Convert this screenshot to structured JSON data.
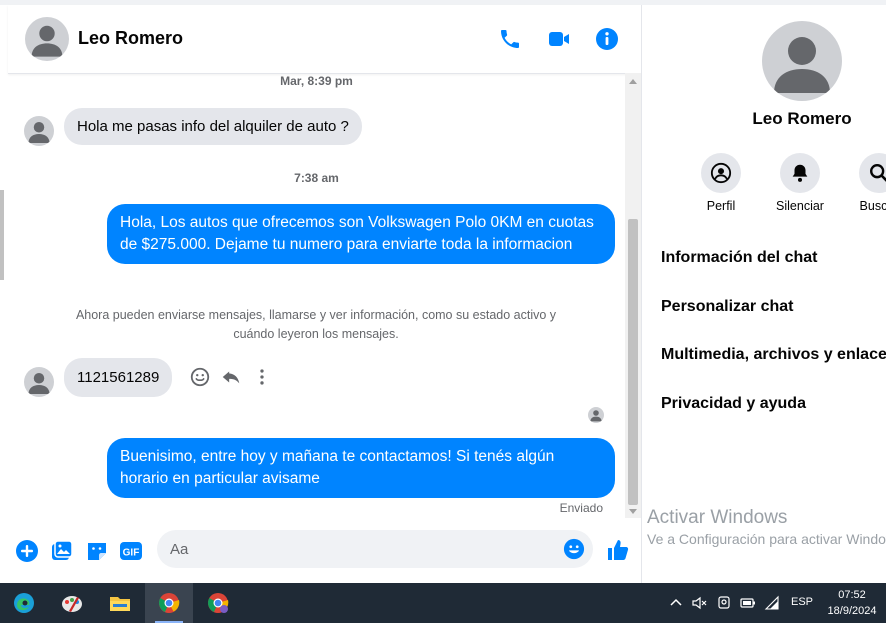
{
  "contact": {
    "name": "Leo Romero"
  },
  "messages": {
    "ts1": "Mar, 8:39 pm",
    "m1": "Hola me pasas info del alquiler de auto ?",
    "ts2": "7:38 am",
    "m2": "Hola, Los autos que ofrecemos son Volkswagen Polo 0KM en cuotas de $275.000. Dejame tu numero para enviarte toda la informacion",
    "system": "Ahora pueden enviarse mensajes, llamarse y ver información, como su estado activo y cuándo leyeron los mensajes.",
    "m3": "1121561289",
    "m4": "Buenisimo, entre hoy y mañana te contactamos! Si tenés algún horario en particular avisame",
    "status": "Enviado"
  },
  "composer": {
    "placeholder": "Aa"
  },
  "sidebar": {
    "name": "Leo Romero",
    "actions": [
      "Perfil",
      "Silenciar",
      "Buscar"
    ],
    "items": [
      "Información del chat",
      "Personalizar chat",
      "Multimedia, archivos y enlaces",
      "Privacidad y ayuda"
    ]
  },
  "watermark": {
    "line1": "Activar Windows",
    "line2": "Ve a Configuración para activar Windows."
  },
  "taskbar": {
    "lang": "ESP",
    "time": "07:52",
    "date": "18/9/2024"
  },
  "colors": {
    "accent": "#0084ff",
    "bubble_in": "#e4e6eb",
    "taskbar": "#1f2a36"
  },
  "icons": [
    "phone-icon",
    "video-icon",
    "info-icon",
    "smiley-icon",
    "reply-icon",
    "more-icon",
    "plus-icon",
    "image-icon",
    "sticker-icon",
    "gif-icon",
    "like-icon",
    "user-icon",
    "bell-icon",
    "search-icon"
  ]
}
